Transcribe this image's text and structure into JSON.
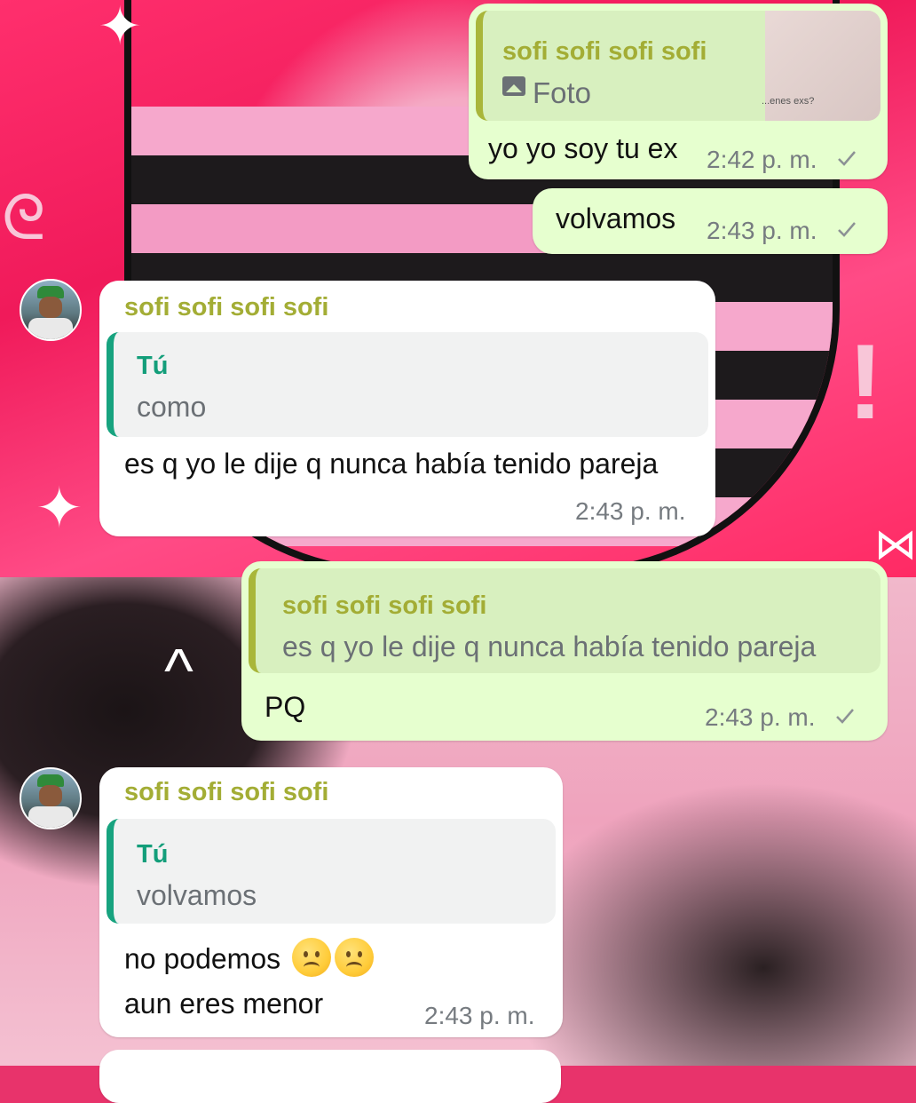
{
  "messages": {
    "m1": {
      "quote_author": "sofi sofi sofi sofi",
      "quote_text": "Foto",
      "quote_thumb_text": "...enes exs?",
      "text": "yo yo soy tu ex",
      "time": "2:42 p. m."
    },
    "m2": {
      "text": "volvamos",
      "time": "2:43 p. m."
    },
    "m3": {
      "sender": "sofi sofi sofi sofi",
      "quote_author": "Tú",
      "quote_text": "como",
      "text": "es q yo le dije q nunca había tenido pareja",
      "time": "2:43 p. m."
    },
    "m4": {
      "quote_author": "sofi sofi sofi sofi",
      "quote_text": "es q yo le dije q nunca había tenido pareja",
      "text": "PQ",
      "time": "2:43 p. m."
    },
    "m5": {
      "sender": "sofi sofi sofi sofi",
      "quote_author": "Tú",
      "quote_text": "volvamos",
      "text_line1": "no podemos",
      "text_line2": "aun eres menor",
      "emojis": [
        "frowning-face",
        "frowning-face"
      ],
      "time": "2:43 p. m."
    }
  },
  "colors": {
    "outgoing_bubble": "#e6ffcf",
    "incoming_bubble": "#ffffff",
    "quote_bar_sofi": "#a9b63a",
    "quote_bar_me": "#17a37f",
    "sender_name": "#a3ad35"
  }
}
